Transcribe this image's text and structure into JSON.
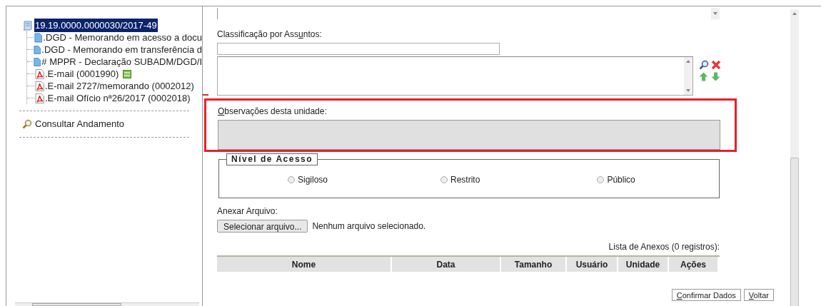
{
  "tree": {
    "root": {
      "label": "19.19.0000.0000030/2017-49",
      "selected": true
    },
    "children": [
      {
        "kind": "document",
        "label": ".DGD - Memorando em acesso a docu",
        "flagged": false
      },
      {
        "kind": "document",
        "label": ".DGD - Memorando em transferência d",
        "flagged": false
      },
      {
        "kind": "document",
        "label": "# MPPR - Declaração SUBADM/DGD/I",
        "flagged": false
      },
      {
        "kind": "pdf",
        "label": ".E-mail (0001990)",
        "flagged": true
      },
      {
        "kind": "pdf",
        "label": ".E-mail 2727/memorando (0002012)",
        "flagged": false
      },
      {
        "kind": "pdf",
        "label": ".E-mail Ofício nª26/2017 (0002018)",
        "flagged": false
      }
    ]
  },
  "sidebar_link": "Consultar Andamento",
  "classificacao": {
    "label": [
      {
        "text": "Classificação por Ass",
        "underlined": false
      },
      {
        "text": "u",
        "underlined": true
      },
      {
        "text": "ntos:",
        "underlined": false
      }
    ]
  },
  "observacoes": {
    "label": [
      {
        "text": "O",
        "underlined": true
      },
      {
        "text": "bservações desta unidade:",
        "underlined": false
      }
    ],
    "highlighted": true
  },
  "nivel_acesso": {
    "legend": "Nível de Acesso",
    "options": [
      {
        "label": "Sigiloso",
        "checked": false
      },
      {
        "label": "Restrito",
        "checked": false
      },
      {
        "label": "Público",
        "checked": false
      }
    ]
  },
  "anexar": {
    "label": "Anexar Arquivo:",
    "button": "Selecionar arquivo...",
    "status": "Nenhum arquivo selecionado."
  },
  "anexos": {
    "caption": "Lista de Anexos (0 registros):",
    "columns": [
      "Nome",
      "Data",
      "Tamanho",
      "Usuário",
      "Unidade",
      "Ações"
    ]
  },
  "buttons": [
    {
      "label": [
        {
          "text": "C",
          "underlined": true
        },
        {
          "text": "onfirmar Dados",
          "underlined": false
        }
      ]
    },
    {
      "label": [
        {
          "text": "V",
          "underlined": true
        },
        {
          "text": "oltar",
          "underlined": false
        }
      ]
    }
  ]
}
